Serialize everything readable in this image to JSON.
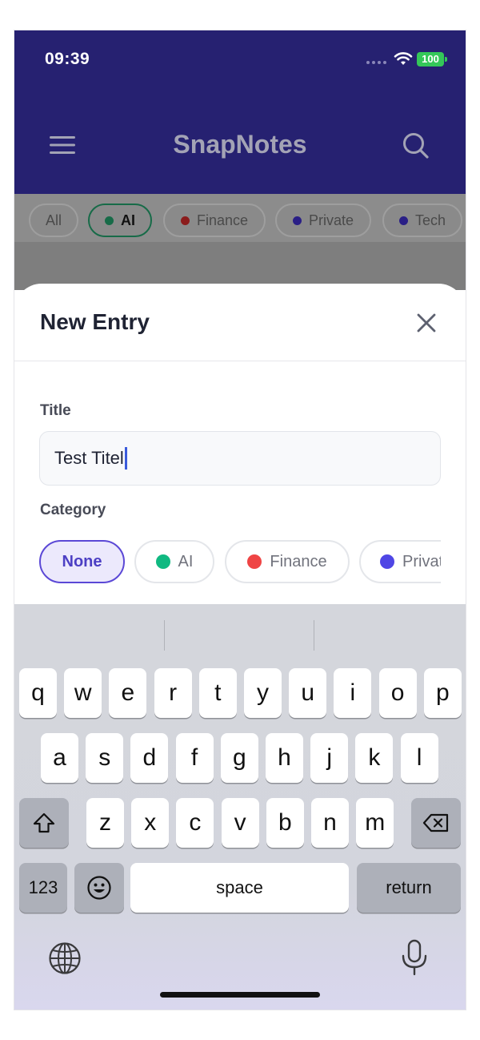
{
  "status_bar": {
    "time": "09:39",
    "battery": "100"
  },
  "header": {
    "title": "SnapNotes",
    "menu_icon": "hamburger-menu-icon",
    "search_icon": "search-icon"
  },
  "filters": [
    {
      "label": "All",
      "dot": null,
      "selected": false
    },
    {
      "label": "AI",
      "dot": "#176b48",
      "selected": true
    },
    {
      "label": "Finance",
      "dot": "#8b1c1c",
      "selected": false
    },
    {
      "label": "Private",
      "dot": "#2a1f86",
      "selected": false
    },
    {
      "label": "Tech",
      "dot": "#2a1f86",
      "selected": false
    }
  ],
  "sheet": {
    "title": "New Entry",
    "title_label": "Title",
    "title_value": "Test Titel",
    "category_label": "Category",
    "categories": [
      {
        "label": "None",
        "dot": null,
        "selected": true
      },
      {
        "label": "AI",
        "dot": "#10b981",
        "selected": false
      },
      {
        "label": "Finance",
        "dot": "#ef4444",
        "selected": false
      },
      {
        "label": "Private",
        "dot": "#4f46e5",
        "selected": false
      }
    ]
  },
  "keyboard": {
    "row1": [
      "q",
      "w",
      "e",
      "r",
      "t",
      "y",
      "u",
      "i",
      "o",
      "p"
    ],
    "row2": [
      "a",
      "s",
      "d",
      "f",
      "g",
      "h",
      "j",
      "k",
      "l"
    ],
    "row3": [
      "z",
      "x",
      "c",
      "v",
      "b",
      "n",
      "m"
    ],
    "numbers_key": "123",
    "space_key": "space",
    "return_key": "return"
  },
  "colors": {
    "header_bg": "#262171",
    "accent": "#5b48d6",
    "selected_filter": "#176b48"
  }
}
